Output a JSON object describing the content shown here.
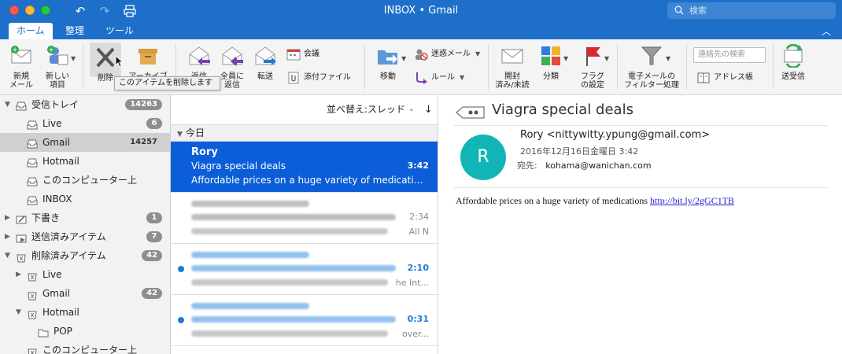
{
  "window": {
    "title": "INBOX • Gmail",
    "search_placeholder": "検索"
  },
  "ribbon_tabs": [
    "ホーム",
    "整理",
    "ツール"
  ],
  "ribbon": {
    "new_mail": "新規\nメール",
    "new_items": "新しい\n項目",
    "delete": "削除",
    "archive": "アーカイブ",
    "reply": "返信",
    "reply_all": "全員に\n返信",
    "forward": "転送",
    "meeting": "会議",
    "attachment": "添付ファイル",
    "move": "移動",
    "junk": "迷惑メール",
    "rules": "ルール",
    "read_unread": "開封\n済み/未読",
    "categorize": "分類",
    "follow_up": "フラグ\nの設定",
    "filter": "電子メールの\nフィルター処理",
    "contacts_search": "連絡先の検索",
    "address_book": "アドレス帳",
    "send_receive": "送受信"
  },
  "tooltip": "このアイテムを削除します",
  "folders": [
    {
      "label": "受信トレイ",
      "badge": "14263",
      "level": 0,
      "icon": "inbox-icon",
      "arrow": "down"
    },
    {
      "label": "Live",
      "badge": "6",
      "level": 1,
      "icon": "inbox-icon",
      "arrow": ""
    },
    {
      "label": "Gmail",
      "badge": "14257",
      "level": 1,
      "icon": "inbox-icon",
      "arrow": "",
      "selected": true,
      "plain": true
    },
    {
      "label": "Hotmail",
      "badge": "",
      "level": 1,
      "icon": "inbox-icon",
      "arrow": ""
    },
    {
      "label": "このコンピューター上",
      "badge": "",
      "level": 1,
      "icon": "inbox-icon",
      "arrow": ""
    },
    {
      "label": "INBOX",
      "badge": "",
      "level": 1,
      "icon": "inbox-icon",
      "arrow": ""
    },
    {
      "label": "下書き",
      "badge": "1",
      "level": 0,
      "icon": "draft-icon",
      "arrow": "right"
    },
    {
      "label": "送信済みアイテム",
      "badge": "7",
      "level": 0,
      "icon": "sent-icon",
      "arrow": "right"
    },
    {
      "label": "削除済みアイテム",
      "badge": "42",
      "level": 0,
      "icon": "trash-icon",
      "arrow": "down"
    },
    {
      "label": "Live",
      "badge": "",
      "level": 1,
      "icon": "trash-icon",
      "arrow": "right"
    },
    {
      "label": "Gmail",
      "badge": "42",
      "level": 1,
      "icon": "trash-icon",
      "arrow": ""
    },
    {
      "label": "Hotmail",
      "badge": "",
      "level": 1,
      "icon": "trash-icon",
      "arrow": "down"
    },
    {
      "label": "POP",
      "badge": "",
      "level": 2,
      "icon": "folder-icon",
      "arrow": ""
    },
    {
      "label": "このコンピューター上",
      "badge": "",
      "level": 1,
      "icon": "trash-icon",
      "arrow": ""
    }
  ],
  "list": {
    "sort_label": "並べ替え:スレッド",
    "group": "今日",
    "messages": [
      {
        "sender": "Rory",
        "subject": "Viagra special deals",
        "preview": "Affordable prices on a huge variety of medications ht...",
        "time": "3:42",
        "selected": true,
        "unread": false
      },
      {
        "sender": "",
        "subject": "",
        "preview": "All N",
        "time": "2:34",
        "selected": false,
        "unread": false
      },
      {
        "sender": "",
        "subject": "",
        "preview": "he Int...",
        "time": "2:10",
        "selected": false,
        "unread": true
      },
      {
        "sender": "",
        "subject": "",
        "preview": "over...",
        "time": "0:31",
        "selected": false,
        "unread": true
      }
    ]
  },
  "reading": {
    "subject": "Viagra special deals",
    "avatar": "R",
    "from": "Rory <nittywitty.ypung@gmail.com>",
    "date": "2016年12月16日金曜日 3:42",
    "to_label": "宛先:",
    "to": "kohama@wanichan.com",
    "body_text": "Affordable prices on a huge variety of medications",
    "body_link": "http://bit.ly/2gGC1TB"
  },
  "colors": {
    "titlebar": "#1d6fc9",
    "selection": "#0b5ed7",
    "avatar": "#12b5b5"
  }
}
